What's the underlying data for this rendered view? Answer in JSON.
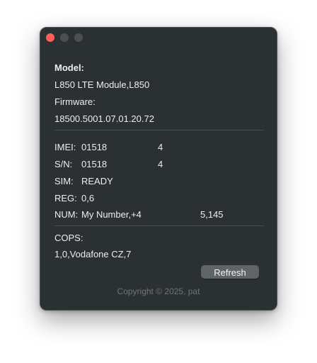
{
  "window": {
    "traffic_lights": {
      "close_color": "#fe5f57",
      "minimize_color": "#4b4f52",
      "zoom_color": "#4b4f52"
    }
  },
  "model_section": {
    "model_label": "Model:",
    "model_value": "L850 LTE Module,L850",
    "firmware_label": "Firmware:",
    "firmware_value": "18500.5001.07.01.20.72"
  },
  "info_section": {
    "imei_label": "IMEI:",
    "imei_value": "01518",
    "imei_tail": "4",
    "sn_label": "S/N:",
    "sn_value": "01518",
    "sn_tail": "4",
    "sim_label": "SIM:",
    "sim_value": "READY",
    "reg_label": "REG:",
    "reg_value": "0,6",
    "num_label": "NUM:",
    "num_value": "My Number,+4",
    "num_tail": "5,145"
  },
  "cops_section": {
    "cops_label": "COPS:",
    "cops_value": "1,0,Vodafone CZ,7"
  },
  "actions": {
    "refresh_label": "Refresh"
  },
  "footer": {
    "copyright": "Copyright © 2025, pat"
  },
  "colors": {
    "window_bg": "#2b3032",
    "text": "#eceeef",
    "button_bg": "#5f6467",
    "footer_text": "#6e7477"
  }
}
